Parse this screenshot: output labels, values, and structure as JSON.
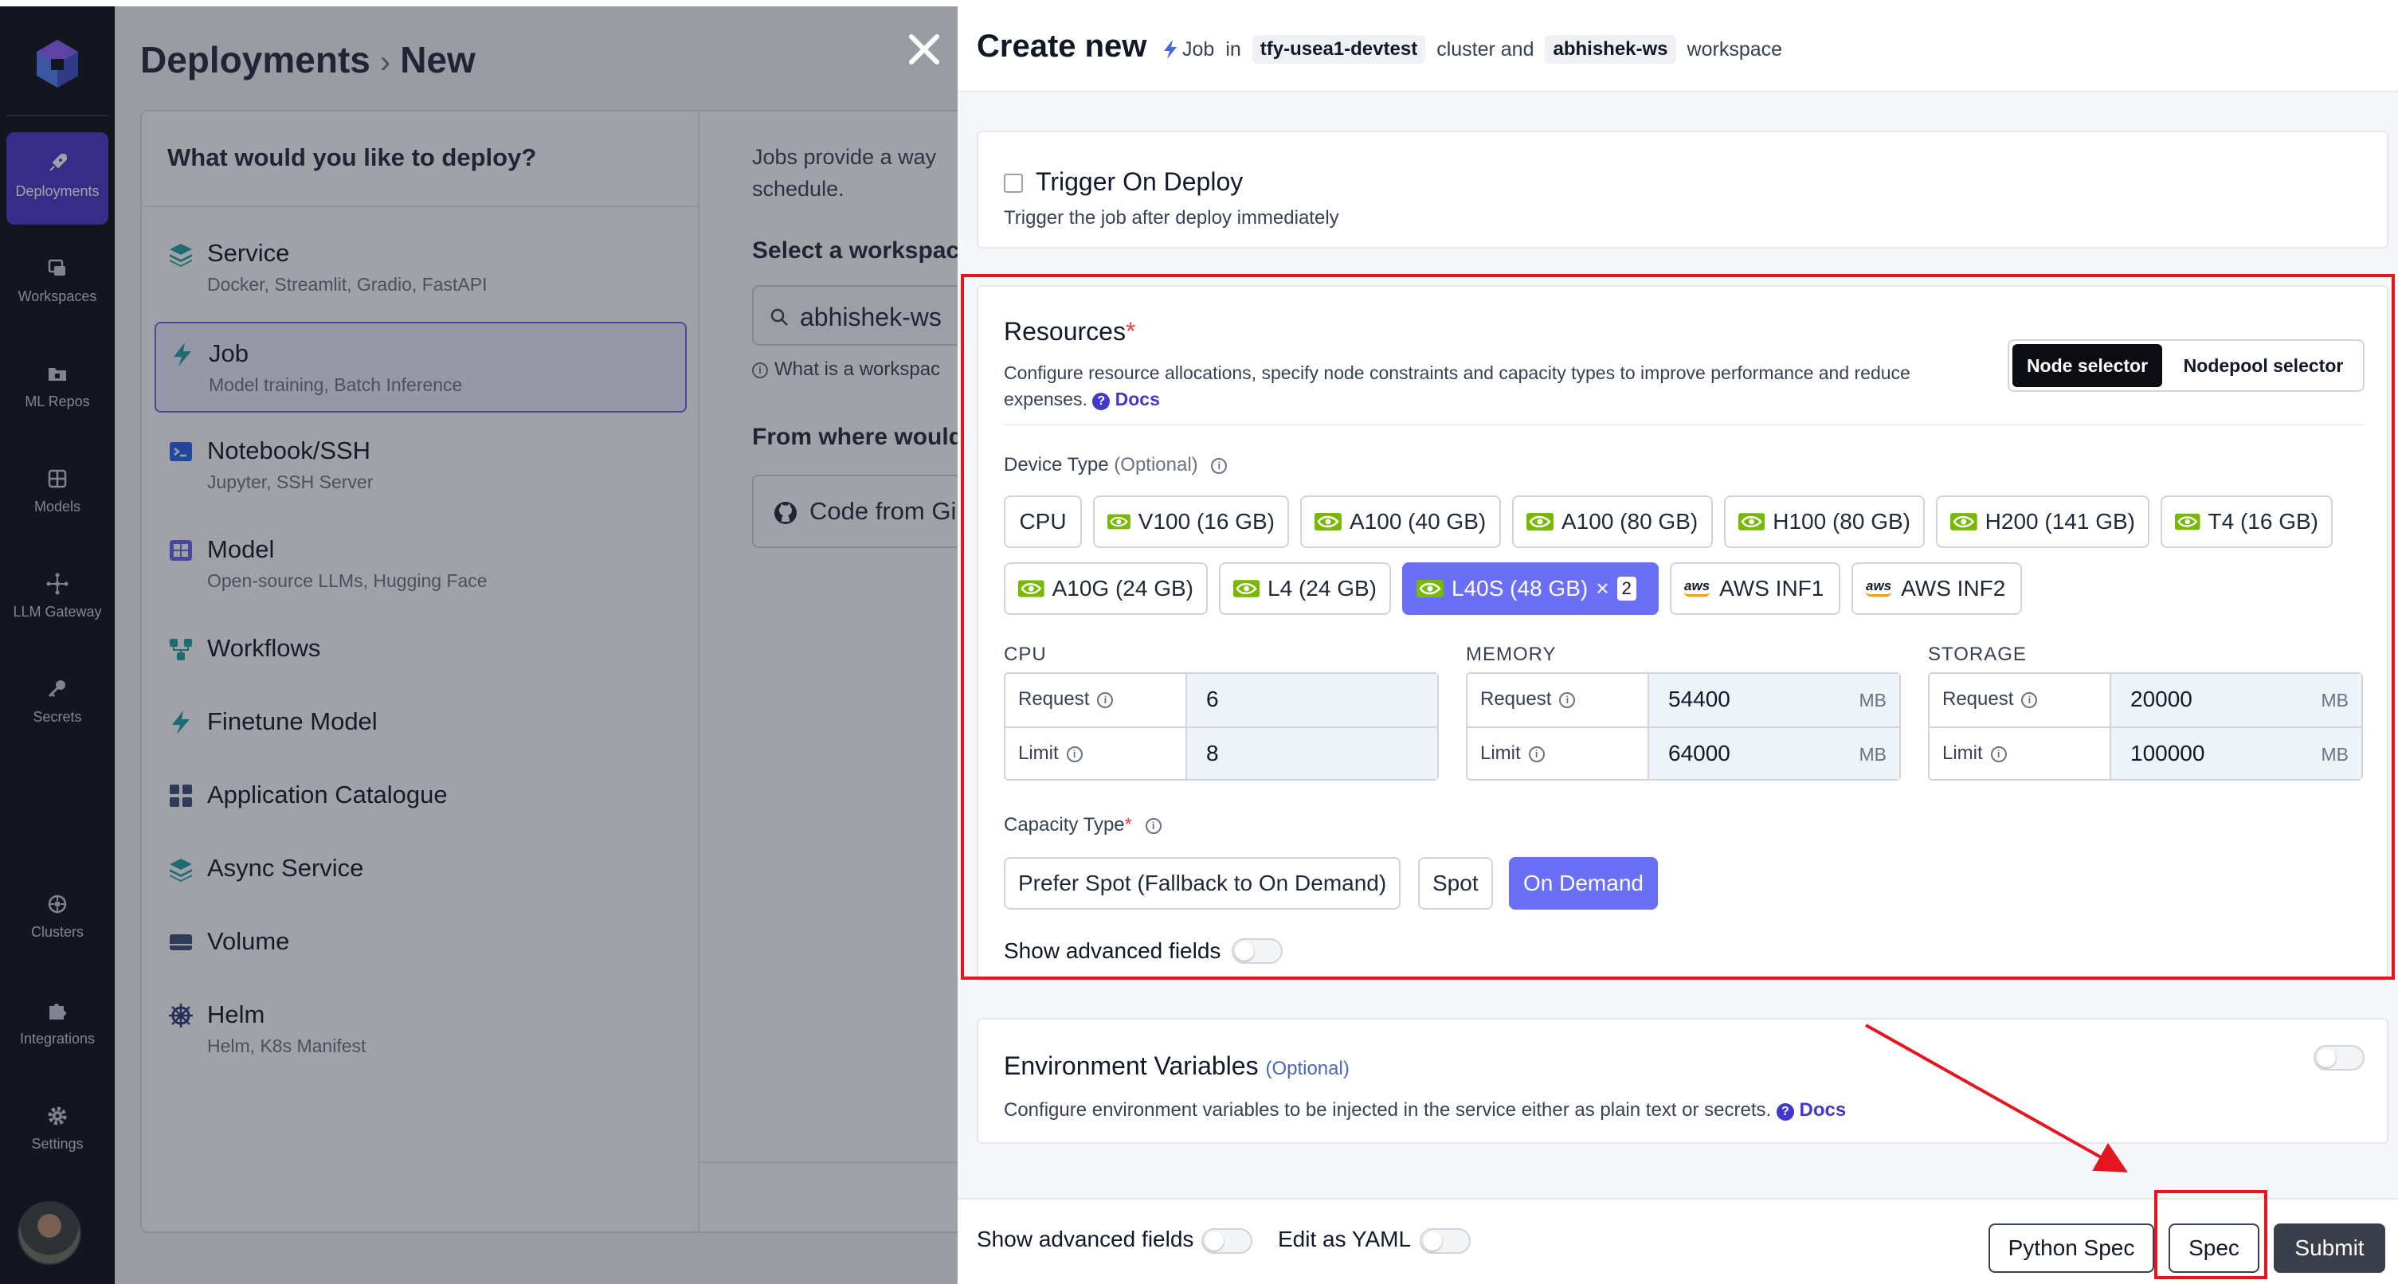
{
  "nav": {
    "items": [
      {
        "label": "Deployments",
        "icon": "rocket-icon"
      },
      {
        "label": "Workspaces",
        "icon": "workspaces-icon"
      },
      {
        "label": "ML Repos",
        "icon": "folder-icon"
      },
      {
        "label": "Models",
        "icon": "grid-icon"
      },
      {
        "label": "LLM Gateway",
        "icon": "gateway-icon"
      },
      {
        "label": "Secrets",
        "icon": "key-icon"
      },
      {
        "label": "Clusters",
        "icon": "cluster-icon"
      },
      {
        "label": "Integrations",
        "icon": "puzzle-icon"
      },
      {
        "label": "Settings",
        "icon": "gear-icon"
      }
    ]
  },
  "background": {
    "breadcrumb": {
      "root": "Deployments",
      "current": "New"
    },
    "question": "What would you like to deploy?",
    "deploy_options": [
      {
        "title": "Service",
        "subtitle": "Docker, Streamlit, Gradio, FastAPI"
      },
      {
        "title": "Job",
        "subtitle": "Model training, Batch Inference"
      },
      {
        "title": "Notebook/SSH",
        "subtitle": "Jupyter, SSH Server"
      },
      {
        "title": "Model",
        "subtitle": "Open-source LLMs, Hugging Face"
      },
      {
        "title": "Workflows",
        "subtitle": ""
      },
      {
        "title": "Finetune Model",
        "subtitle": ""
      },
      {
        "title": "Application Catalogue",
        "subtitle": ""
      },
      {
        "title": "Async Service",
        "subtitle": ""
      },
      {
        "title": "Volume",
        "subtitle": ""
      },
      {
        "title": "Helm",
        "subtitle": "Helm, K8s Manifest"
      }
    ],
    "jobs_desc_line1": "Jobs provide a way",
    "jobs_desc_line2": "schedule.",
    "select_workspace_label": "Select a workspac",
    "workspace_value": "abhishek-ws",
    "what_is_workspace": "What is a workspac",
    "from_where": "From where would",
    "code_from": "Code from Gi"
  },
  "drawer": {
    "title": "Create new",
    "kind": "Job",
    "in_text": "in",
    "cluster": "tfy-usea1-devtest",
    "cluster_text": "cluster and",
    "workspace": "abhishek-ws",
    "workspace_text": "workspace",
    "trigger": {
      "title": "Trigger On Deploy",
      "subtitle": "Trigger the job after deploy immediately",
      "checked": false
    },
    "resources": {
      "title": "Resources",
      "required_mark": "*",
      "description": "Configure resource allocations, specify node constraints and capacity types to improve performance and reduce expenses.",
      "docs_label": "Docs",
      "selector_options": [
        "Node selector",
        "Nodepool selector"
      ],
      "selector_active": "Node selector",
      "device_type_label": "Device Type",
      "device_type_optional": "(Optional)",
      "devices": [
        {
          "label": "CPU",
          "vendor": "none"
        },
        {
          "label": "V100 (16 GB)",
          "vendor": "nvidia"
        },
        {
          "label": "A100 (40 GB)",
          "vendor": "nvidia"
        },
        {
          "label": "A100 (80 GB)",
          "vendor": "nvidia"
        },
        {
          "label": "H100 (80 GB)",
          "vendor": "nvidia"
        },
        {
          "label": "H200 (141 GB)",
          "vendor": "nvidia"
        },
        {
          "label": "T4 (16 GB)",
          "vendor": "nvidia"
        },
        {
          "label": "A10G (24 GB)",
          "vendor": "nvidia"
        },
        {
          "label": "L4 (24 GB)",
          "vendor": "nvidia"
        },
        {
          "label": "L40S (48 GB)",
          "vendor": "nvidia",
          "selected": true,
          "count": "2"
        },
        {
          "label": "AWS INF1",
          "vendor": "aws"
        },
        {
          "label": "AWS INF2",
          "vendor": "aws"
        }
      ],
      "multiply_sign": "×",
      "aws_logo_text": "aws",
      "groups": [
        {
          "name": "CPU",
          "request": "6",
          "limit": "8",
          "unit": ""
        },
        {
          "name": "MEMORY",
          "request": "54400",
          "limit": "64000",
          "unit": "MB"
        },
        {
          "name": "STORAGE",
          "request": "20000",
          "limit": "100000",
          "unit": "MB"
        }
      ],
      "request_label": "Request",
      "limit_label": "Limit",
      "capacity_type_label": "Capacity Type",
      "capacity_options": [
        "Prefer Spot (Fallback to On Demand)",
        "Spot",
        "On Demand"
      ],
      "capacity_selected": "On Demand",
      "show_advanced_label": "Show advanced fields"
    },
    "env": {
      "title": "Environment Variables",
      "optional": "(Optional)",
      "description": "Configure environment variables to be injected in the service either as plain text or secrets.",
      "docs_label": "Docs"
    },
    "footer": {
      "show_advanced_label": "Show advanced fields",
      "edit_yaml_label": "Edit as YAML",
      "python_spec_label": "Python Spec",
      "spec_label": "Spec",
      "submit_label": "Submit"
    }
  },
  "colors": {
    "accent": "#6b6ff5",
    "nav_active": "#4c35c9",
    "highlight": "#e5161f",
    "nvidia_green": "#76b900"
  }
}
